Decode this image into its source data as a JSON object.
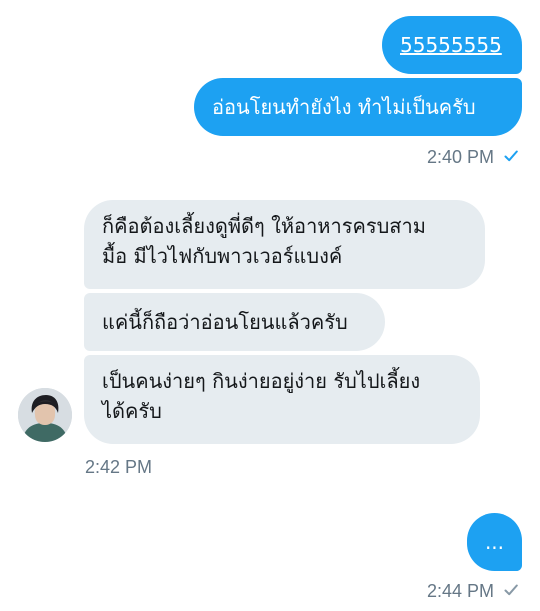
{
  "conversation": {
    "outgoing": [
      {
        "text": "55555555"
      },
      {
        "text": "อ่อนโยนทำยังไง ทำไม่เป็นครับ"
      }
    ],
    "outgoing_time": "2:40 PM",
    "incoming": [
      {
        "line1": "ก็คือต้องเลี้ยงดูพี่ดีๆ ให้อาหารครบสาม",
        "line2": "มื้อ มีไวไฟกับพาวเวอร์แบงค์"
      },
      {
        "text": "แค่นี้ก็ถือว่าอ่อนโยนแล้วครับ"
      },
      {
        "line1": "เป็นคนง่ายๆ กินง่ายอยู่ง่าย รับไปเลี้ยง",
        "line2": "ได้ครับ"
      }
    ],
    "incoming_time": "2:42 PM",
    "last_outgoing": {
      "text": "..."
    },
    "last_time": "2:44 PM"
  },
  "icons": {
    "read_status": "check-icon",
    "sender": "avatar"
  },
  "colors": {
    "outgoing_bubble": "#1da1f2",
    "incoming_bubble": "#e6ecf0",
    "meta_text": "#657786",
    "read_check": "#1da1f2",
    "sent_check": "#8899a6"
  }
}
